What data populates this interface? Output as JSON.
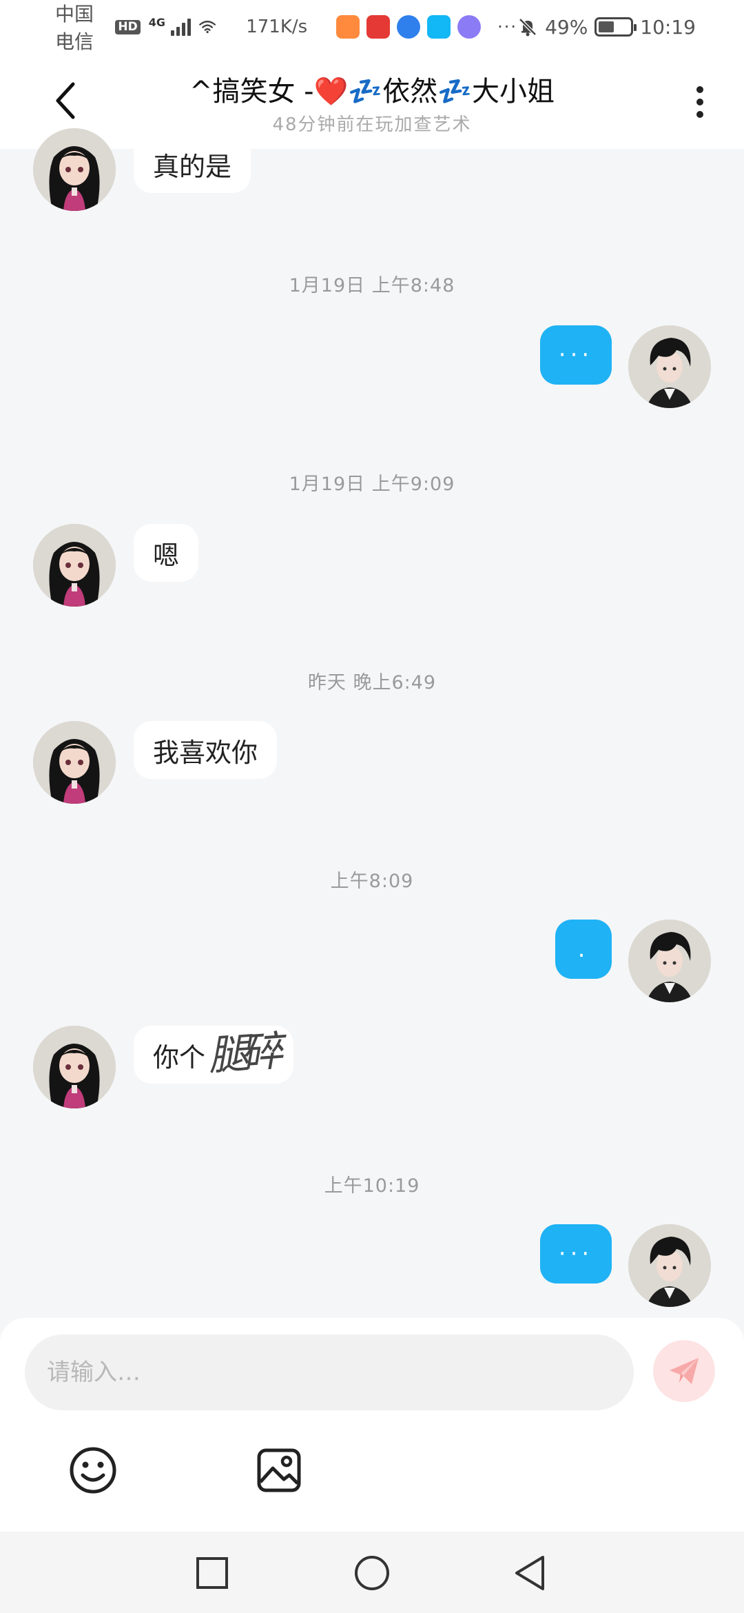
{
  "status_bar": {
    "carrier": "中国电信",
    "hd_badge": "HD",
    "network": "4G",
    "speed": "171K/s",
    "more": "···",
    "battery": "49%",
    "battery_level": 0.49,
    "time": "10:19",
    "app_icon_colors": [
      "#ff8a3d",
      "#e53935",
      "#2f80ed",
      "#12b7f5",
      "#8b7cf6"
    ]
  },
  "header": {
    "title": "^搞笑女 -❤️💤依然💤大小姐",
    "subtitle": "48分钟前在玩加查艺术"
  },
  "messages": {
    "m0_text": "真的是",
    "ts1": "1月19日 上午8:48",
    "m1_text": "···",
    "ts2": "1月19日 上午9:09",
    "m2_text": "嗯",
    "ts3": "昨天 晚上6:49",
    "m3_text": "我喜欢你",
    "ts4": "上午8:09",
    "m4_text": ".",
    "m5_text": "你个",
    "m5_sticker": "腿碎",
    "ts5": "上午10:19",
    "m6_text": "···"
  },
  "input": {
    "placeholder": "请输入…",
    "value": ""
  },
  "colors": {
    "accent": "#1fb2f4",
    "send_button": "#fde3e3",
    "background": "#f5f6f8"
  },
  "icons": {
    "back": "chevron-left-icon",
    "more": "more-vertical-icon",
    "send": "paper-plane-icon",
    "emoji": "smiley-icon",
    "image": "image-icon",
    "nav_recent": "square-icon",
    "nav_home": "circle-icon",
    "nav_back": "triangle-back-icon"
  }
}
